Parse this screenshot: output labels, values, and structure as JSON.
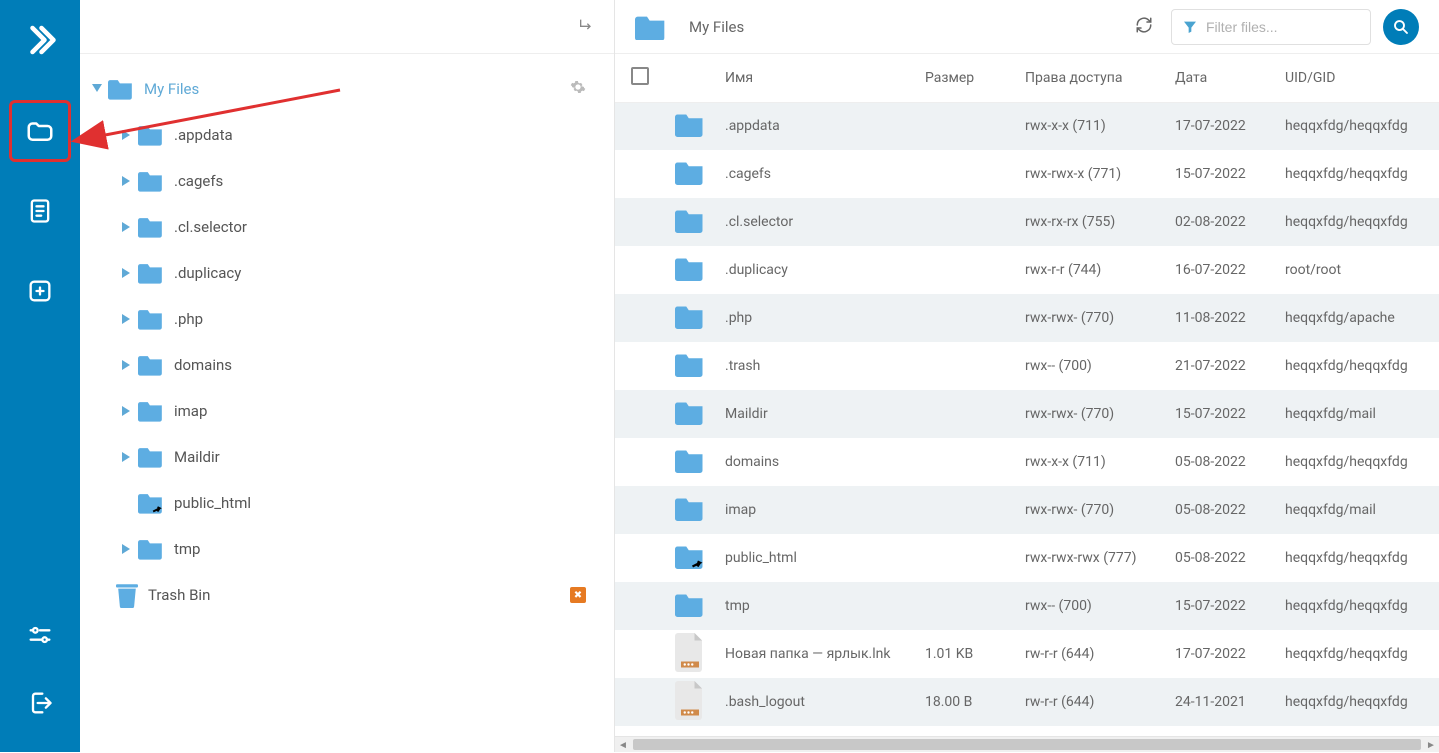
{
  "colors": {
    "brand": "#007db8",
    "folder": "#5dade2",
    "red": "#e03030"
  },
  "rail": {
    "items": [
      {
        "name": "files",
        "active": true
      },
      {
        "name": "document",
        "active": false
      },
      {
        "name": "add",
        "active": false
      }
    ]
  },
  "tree": {
    "root_label": "My Files",
    "items": [
      {
        "label": ".appdata",
        "expandable": true
      },
      {
        "label": ".cagefs",
        "expandable": true
      },
      {
        "label": ".cl.selector",
        "expandable": true
      },
      {
        "label": ".duplicacy",
        "expandable": true
      },
      {
        "label": ".php",
        "expandable": true
      },
      {
        "label": "domains",
        "expandable": true
      },
      {
        "label": "imap",
        "expandable": true
      },
      {
        "label": "Maildir",
        "expandable": true
      },
      {
        "label": "public_html",
        "expandable": false,
        "link": true
      },
      {
        "label": "tmp",
        "expandable": true
      }
    ],
    "trash_label": "Trash Bin"
  },
  "breadcrumb": {
    "label": "My Files"
  },
  "filter": {
    "placeholder": "Filter files..."
  },
  "table": {
    "headers": {
      "name": "Имя",
      "size": "Размер",
      "perm": "Права доступа",
      "date": "Дата",
      "uid": "UID/GID"
    },
    "rows": [
      {
        "icon": "folder",
        "name": ".appdata",
        "size": "",
        "perm": "rwx-x-x (711)",
        "date": "17-07-2022",
        "uid": "heqqxfdg/heqqxfdg"
      },
      {
        "icon": "folder",
        "name": ".cagefs",
        "size": "",
        "perm": "rwx-rwx-x (771)",
        "date": "15-07-2022",
        "uid": "heqqxfdg/heqqxfdg"
      },
      {
        "icon": "folder",
        "name": ".cl.selector",
        "size": "",
        "perm": "rwx-rx-rx (755)",
        "date": "02-08-2022",
        "uid": "heqqxfdg/heqqxfdg"
      },
      {
        "icon": "folder",
        "name": ".duplicacy",
        "size": "",
        "perm": "rwx-r-r (744)",
        "date": "16-07-2022",
        "uid": "root/root"
      },
      {
        "icon": "folder",
        "name": ".php",
        "size": "",
        "perm": "rwx-rwx- (770)",
        "date": "11-08-2022",
        "uid": "heqqxfdg/apache"
      },
      {
        "icon": "folder",
        "name": ".trash",
        "size": "",
        "perm": "rwx-- (700)",
        "date": "21-07-2022",
        "uid": "heqqxfdg/heqqxfdg"
      },
      {
        "icon": "folder",
        "name": "Maildir",
        "size": "",
        "perm": "rwx-rwx- (770)",
        "date": "15-07-2022",
        "uid": "heqqxfdg/mail"
      },
      {
        "icon": "folder",
        "name": "domains",
        "size": "",
        "perm": "rwx-x-x (711)",
        "date": "05-08-2022",
        "uid": "heqqxfdg/heqqxfdg"
      },
      {
        "icon": "folder",
        "name": "imap",
        "size": "",
        "perm": "rwx-rwx- (770)",
        "date": "05-08-2022",
        "uid": "heqqxfdg/mail"
      },
      {
        "icon": "folder-link",
        "name": "public_html",
        "size": "",
        "perm": "rwx-rwx-rwx (777)",
        "date": "05-08-2022",
        "uid": "heqqxfdg/heqqxfdg"
      },
      {
        "icon": "folder",
        "name": "tmp",
        "size": "",
        "perm": "rwx-- (700)",
        "date": "15-07-2022",
        "uid": "heqqxfdg/heqqxfdg"
      },
      {
        "icon": "file",
        "name": "Новая папка — ярлык.lnk",
        "size": "1.01 KB",
        "perm": "rw-r-r (644)",
        "date": "17-07-2022",
        "uid": "heqqxfdg/heqqxfdg"
      },
      {
        "icon": "file",
        "name": ".bash_logout",
        "size": "18.00 B",
        "perm": "rw-r-r (644)",
        "date": "24-11-2021",
        "uid": "heqqxfdg/heqqxfdg"
      }
    ]
  }
}
